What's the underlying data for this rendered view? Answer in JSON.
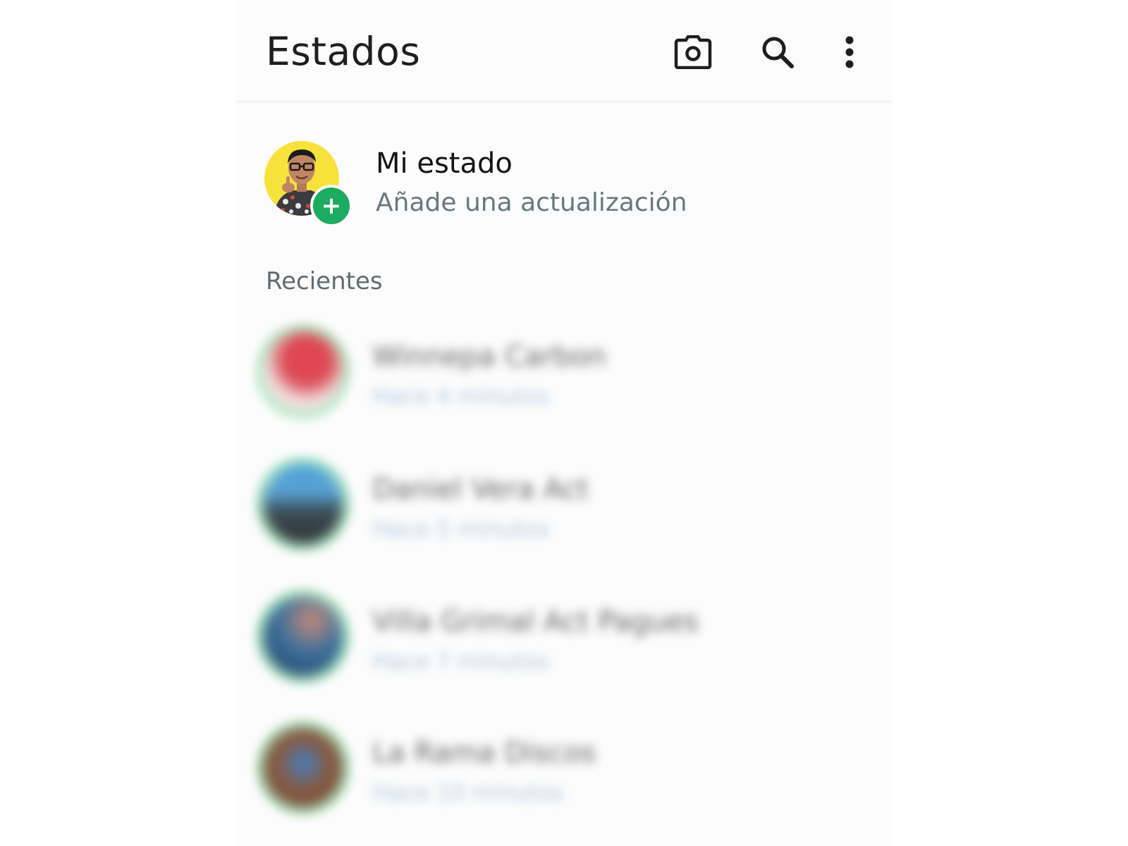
{
  "header": {
    "title": "Estados",
    "icons": [
      "camera-icon",
      "search-icon",
      "more-vert-icon"
    ]
  },
  "my_status": {
    "name": "Mi estado",
    "subtitle": "Añade una actualización",
    "badge_icon": "plus-icon",
    "accent": "#1daa61"
  },
  "recent": {
    "label": "Recientes",
    "ring_color": "#b8ecc9",
    "items": [
      {
        "name": "Winnepa Carbon",
        "time": "Hace 4 minutos"
      },
      {
        "name": "Daniel Vera Act",
        "time": "Hace 5 minutos"
      },
      {
        "name": "Villa Grimal Act Pagues",
        "time": "Hace 7 minutos"
      },
      {
        "name": "La Rama Discos",
        "time": "Hace 10 minutos"
      }
    ]
  }
}
